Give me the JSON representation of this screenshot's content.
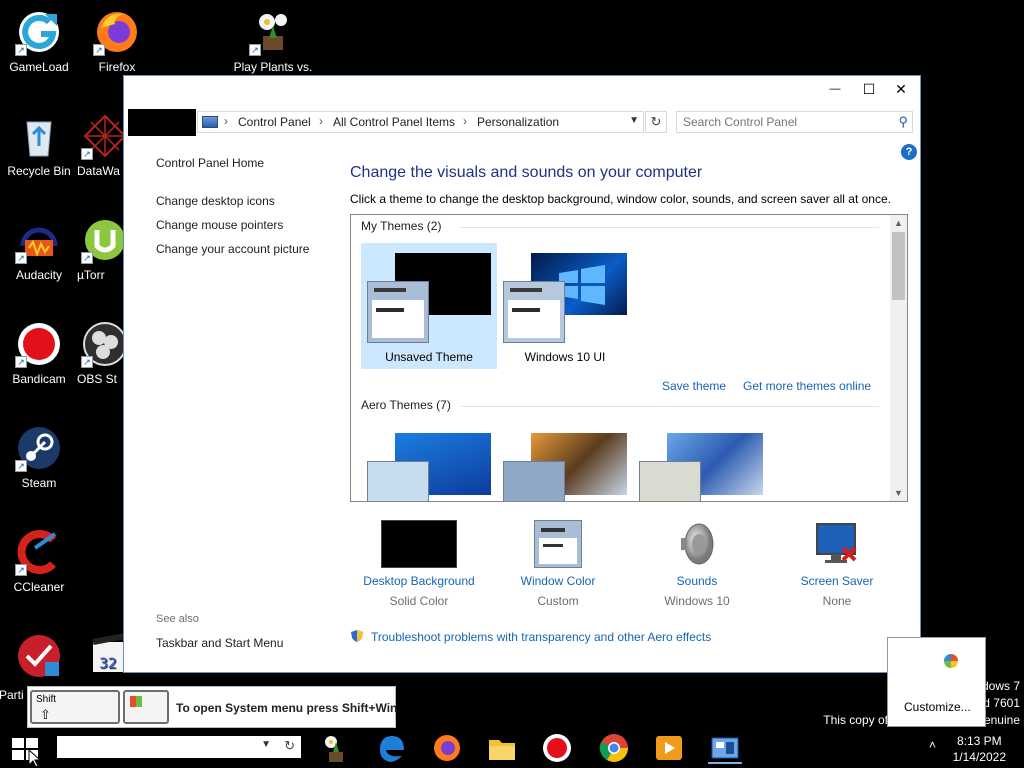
{
  "desktop": {
    "icons": [
      {
        "label": "GameLoad"
      },
      {
        "label": "Firefox"
      },
      {
        "label": "Play Plants vs."
      },
      {
        "label": "Recycle Bin"
      },
      {
        "label": "DataWa"
      },
      {
        "label": "Audacity"
      },
      {
        "label": "µTorr"
      },
      {
        "label": "Bandicam"
      },
      {
        "label": "OBS St"
      },
      {
        "label": "Steam"
      },
      {
        "label": "CCleaner"
      },
      {
        "label": "Parti"
      }
    ],
    "watermark": {
      "line1": "dows 7",
      "line2": "d 7601",
      "line3": "This copy of",
      "line4": "enuine"
    }
  },
  "window": {
    "title_buttons": {
      "minimize": "—",
      "maximize": "☐",
      "close": "✕"
    },
    "address": {
      "crumbs": [
        "Control Panel",
        "All Control Panel Items",
        "Personalization"
      ],
      "separator": "›"
    },
    "search": {
      "placeholder": "Search Control Panel"
    },
    "left_nav": {
      "home": "Control Panel Home",
      "links": [
        "Change desktop icons",
        "Change mouse pointers",
        "Change your account picture"
      ],
      "see_also": "See also",
      "see_also_links": [
        "Taskbar and Start Menu"
      ]
    },
    "heading": "Change the visuals and sounds on your computer",
    "subtext": "Click a theme to change the desktop background, window color, sounds, and screen saver all at once.",
    "my_themes": {
      "label": "My Themes (2)",
      "themes": [
        {
          "name": "Unsaved Theme",
          "selected": true
        },
        {
          "name": "Windows 10 UI",
          "selected": false
        }
      ]
    },
    "links": {
      "save_theme": "Save theme",
      "get_more": "Get more themes online"
    },
    "aero_themes": {
      "label": "Aero Themes (7)"
    },
    "bottom": [
      {
        "label": "Desktop Background",
        "value": "Solid Color",
        "icon": "desktop-background-icon"
      },
      {
        "label": "Window Color",
        "value": "Custom",
        "icon": "window-color-icon"
      },
      {
        "label": "Sounds",
        "value": "Windows 10",
        "icon": "speaker-icon"
      },
      {
        "label": "Screen Saver",
        "value": "None",
        "icon": "screen-saver-icon"
      }
    ],
    "troubleshoot": "Troubleshoot problems with transparency and other Aero effects"
  },
  "keyhint": {
    "shift_key": "Shift",
    "shift_arrow": "⇧",
    "text": "To open System menu press Shift+Win"
  },
  "customize_popup": {
    "button": "Customize..."
  },
  "taskbar": {
    "clock": {
      "time": "8:13 PM",
      "date": "1/14/2022"
    },
    "tray_arrow": "˄"
  },
  "colors": {
    "link": "#1665b3",
    "heading": "#1e3287",
    "selection": "#cce8ff"
  }
}
